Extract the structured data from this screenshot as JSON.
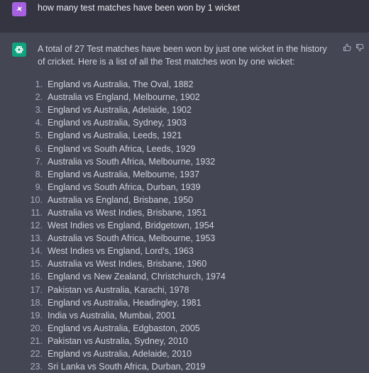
{
  "conversation": {
    "user_message": "how many test matches have been won by 1 wicket",
    "assistant_intro": "A total of 27 Test matches have been won by just one wicket in the history of cricket. Here is a list of all the Test matches won by one wicket:",
    "matches": [
      {
        "num": "1.",
        "text": "England vs Australia, The Oval, 1882"
      },
      {
        "num": "2.",
        "text": "Australia vs England, Melbourne, 1902"
      },
      {
        "num": "3.",
        "text": "England vs Australia, Adelaide, 1902"
      },
      {
        "num": "4.",
        "text": "England vs Australia, Sydney, 1903"
      },
      {
        "num": "5.",
        "text": "England vs Australia, Leeds, 1921"
      },
      {
        "num": "6.",
        "text": "England vs South Africa, Leeds, 1929"
      },
      {
        "num": "7.",
        "text": "Australia vs South Africa, Melbourne, 1932"
      },
      {
        "num": "8.",
        "text": "England vs Australia, Melbourne, 1937"
      },
      {
        "num": "9.",
        "text": "England vs South Africa, Durban, 1939"
      },
      {
        "num": "10.",
        "text": "Australia vs England, Brisbane, 1950"
      },
      {
        "num": "11.",
        "text": "Australia vs West Indies, Brisbane, 1951"
      },
      {
        "num": "12.",
        "text": "West Indies vs England, Bridgetown, 1954"
      },
      {
        "num": "13.",
        "text": "Australia vs South Africa, Melbourne, 1953"
      },
      {
        "num": "14.",
        "text": "West Indies vs England, Lord's, 1963"
      },
      {
        "num": "15.",
        "text": "Australia vs West Indies, Brisbane, 1960"
      },
      {
        "num": "16.",
        "text": "England vs New Zealand, Christchurch, 1974"
      },
      {
        "num": "17.",
        "text": "Pakistan vs Australia, Karachi, 1978"
      },
      {
        "num": "18.",
        "text": "England vs Australia, Headingley, 1981"
      },
      {
        "num": "19.",
        "text": "India vs Australia, Mumbai, 2001"
      },
      {
        "num": "20.",
        "text": "England vs Australia, Edgbaston, 2005"
      },
      {
        "num": "21.",
        "text": "Pakistan vs Australia, Sydney, 2010"
      },
      {
        "num": "22.",
        "text": "England vs Australia, Adelaide, 2010"
      },
      {
        "num": "23.",
        "text": "Sri Lanka vs South Africa, Durban, 2019"
      }
    ]
  },
  "icons": {
    "user_avatar": "user-avatar-icon",
    "assistant_avatar": "openai-logo-icon",
    "thumbs_up": "thumbs-up-icon",
    "thumbs_down": "thumbs-down-icon"
  },
  "colors": {
    "user_bg": "#343541",
    "assistant_bg": "#444654",
    "user_avatar": "#a661e0",
    "assistant_avatar": "#10a37f",
    "text": "#d1d5db"
  }
}
